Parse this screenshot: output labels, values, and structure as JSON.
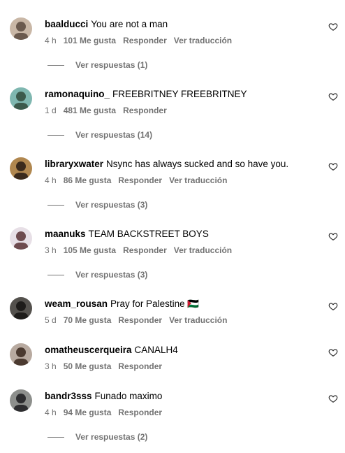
{
  "comments": [
    {
      "username": "baalducci",
      "text": "You are not a man",
      "time": "4 h",
      "likes": "101 Me gusta",
      "reply": "Responder",
      "translate": "Ver traducción",
      "replies": "Ver respuestas (1)",
      "avatar_colors": [
        "#c9b7a6",
        "#6b5a4e"
      ]
    },
    {
      "username": "ramonaquino_",
      "text": "FREEBRITNEY FREEBRITNEY",
      "time": "1 d",
      "likes": "481 Me gusta",
      "reply": "Responder",
      "translate": "",
      "replies": "Ver respuestas (14)",
      "avatar_colors": [
        "#7fb7b0",
        "#3c5a4c"
      ]
    },
    {
      "username": "libraryxwater",
      "text": "Nsync has always sucked and so have you.",
      "time": "4 h",
      "likes": "86 Me gusta",
      "reply": "Responder",
      "translate": "Ver traducción",
      "replies": "Ver respuestas (3)",
      "avatar_colors": [
        "#b0874f",
        "#3a2a1c"
      ]
    },
    {
      "username": "maanuks",
      "text": "TEAM BACKSTREET BOYS",
      "time": "3 h",
      "likes": "105 Me gusta",
      "reply": "Responder",
      "translate": "Ver traducción",
      "replies": "Ver respuestas (3)",
      "avatar_colors": [
        "#e7dfe6",
        "#6e4b4f"
      ]
    },
    {
      "username": "weam_rousan",
      "text": "Pray for Palestine 🇵🇸",
      "time": "5 d",
      "likes": "70 Me gusta",
      "reply": "Responder",
      "translate": "Ver traducción",
      "replies": "",
      "avatar_colors": [
        "#54514d",
        "#1e1c1a"
      ]
    },
    {
      "username": "omatheuscerqueira",
      "text": "CANALH4",
      "time": "3 h",
      "likes": "50 Me gusta",
      "reply": "Responder",
      "translate": "",
      "replies": "",
      "avatar_colors": [
        "#b8aaa0",
        "#4b3a30"
      ]
    },
    {
      "username": "bandr3sss",
      "text": "Funado maximo",
      "time": "4 h",
      "likes": "94 Me gusta",
      "reply": "Responder",
      "translate": "",
      "replies": "Ver respuestas (2)",
      "avatar_colors": [
        "#8d8f8c",
        "#2d2d2f"
      ]
    }
  ]
}
